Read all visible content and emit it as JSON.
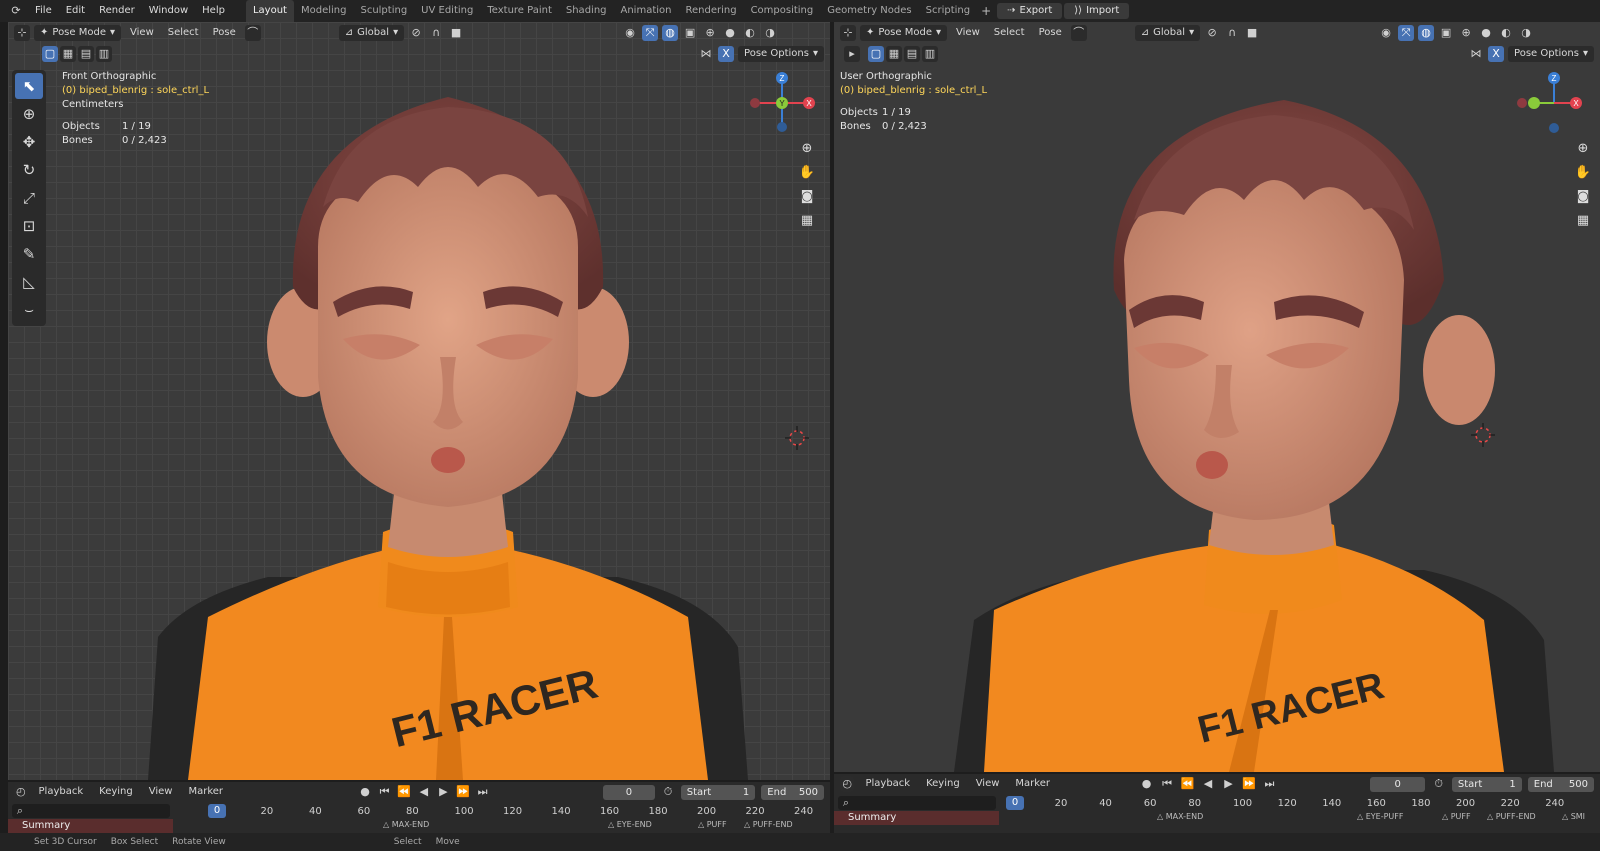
{
  "menu": [
    "File",
    "Edit",
    "Render",
    "Window",
    "Help"
  ],
  "workspaces": [
    "Layout",
    "Modeling",
    "Sculpting",
    "UV Editing",
    "Texture Paint",
    "Shading",
    "Animation",
    "Rendering",
    "Compositing",
    "Geometry Nodes",
    "Scripting"
  ],
  "active_workspace": "Layout",
  "plus": "+",
  "buttons": {
    "export": "Export",
    "import": "Import"
  },
  "left_view": {
    "mode": "Pose Mode",
    "menus": [
      "View",
      "Select",
      "Pose"
    ],
    "transform": "Global",
    "pose_options": "Pose Options",
    "title": "Front Orthographic",
    "object": "(0) biped_blenrig : sole_ctrl_L",
    "units": "Centimeters",
    "objects_label": "Objects",
    "objects_value": "1 / 19",
    "bones_label": "Bones",
    "bones_value": "0 / 2,423"
  },
  "right_view": {
    "mode": "Pose Mode",
    "menus": [
      "View",
      "Select",
      "Pose"
    ],
    "transform": "Global",
    "pose_options": "Pose Options",
    "title": "User Orthographic",
    "object": "(0) biped_blenrig : sole_ctrl_L",
    "objects_label": "Objects",
    "objects_value": "1 / 19",
    "bones_label": "Bones",
    "bones_value": "0 / 2,423"
  },
  "gizmo": {
    "z": "Z",
    "y": "Y",
    "x": "X",
    "close": "X"
  },
  "shirt_text": "F1 RACER",
  "timeline": {
    "menus": [
      "Playback",
      "Keying",
      "View",
      "Marker"
    ],
    "current_frame": "0",
    "start_label": "Start",
    "start_value": "1",
    "end_label": "End",
    "end_value": "500",
    "summary": "Summary",
    "ticks_left": [
      "0",
      "20",
      "40",
      "60",
      "80",
      "100",
      "120",
      "140",
      "160",
      "180",
      "200",
      "220",
      "240"
    ],
    "ticks_right": [
      "0",
      "20",
      "40",
      "60",
      "80",
      "100",
      "120",
      "140",
      "160",
      "180",
      "200",
      "220",
      "240"
    ],
    "markers_left": [
      "MAX-END",
      "EYE-END",
      "PUFF",
      "PUFF-END"
    ],
    "markers_right": [
      "MAX-END",
      "EYE-PUFF",
      "PUFF",
      "PUFF-END",
      "SMI"
    ]
  },
  "status": [
    "Set 3D Cursor",
    "Box Select",
    "Rotate View",
    "Select",
    "Move"
  ],
  "colors": {
    "accent": "#4772b3",
    "skin": "#d69a7d",
    "hair": "#7a4440",
    "shirt": "#f2891f",
    "shirt_dark": "#2b2b2b",
    "gizmo_x": "#e2434f",
    "gizmo_y": "#8acb3a",
    "gizmo_z": "#3a7fd6"
  }
}
